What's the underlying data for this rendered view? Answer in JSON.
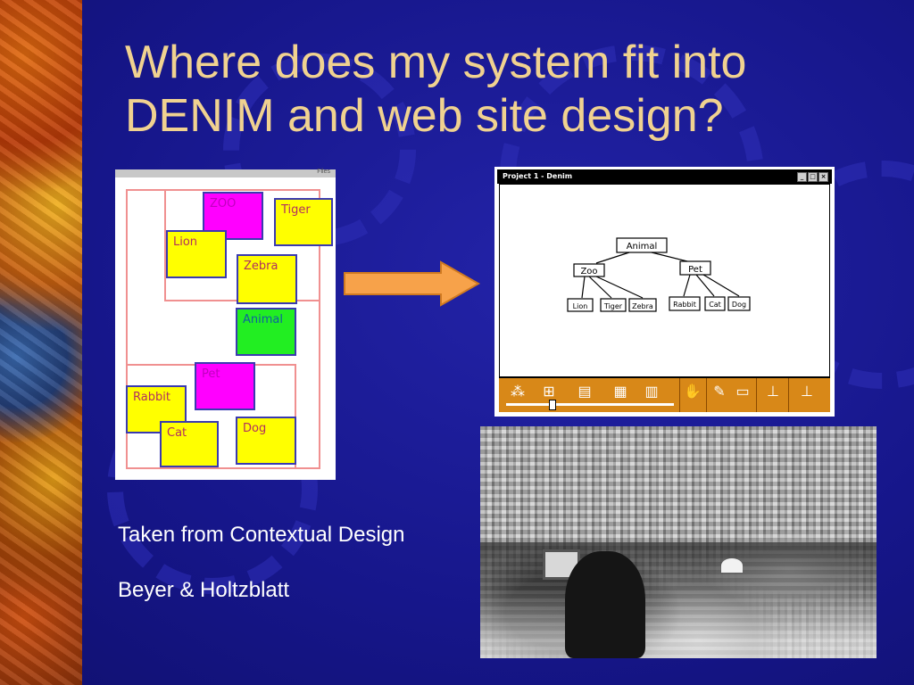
{
  "slide": {
    "title": "Where does my system fit into DENIM and web site design?",
    "caption_line1": "Taken from Contextual Design",
    "caption_line2": "Beyer & Holtzblatt"
  },
  "paper_sketch": {
    "window_label": "Files",
    "notes": [
      "ZOO",
      "Tiger",
      "Lion",
      "Zebra",
      "Animal",
      "Pet",
      "Rabbit",
      "Cat",
      "Dog"
    ]
  },
  "denim_window": {
    "title": "Project 1 - Denim",
    "controls": [
      "_",
      "□",
      "×"
    ],
    "diagram": {
      "root": "Animal",
      "groups": [
        "Zoo",
        "Pet"
      ],
      "leaves": [
        "Lion",
        "Tiger",
        "Zebra",
        "Rabbit",
        "Cat",
        "Dog"
      ]
    },
    "toolbar_icons": [
      "site-map-zoom-icon",
      "storyboard-zoom-icon",
      "sequence-zoom-icon",
      "page-zoom-icon",
      "detail-zoom-icon",
      "hand-icon",
      "pencil-icon",
      "eraser-icon",
      "rubber-stamp-icon",
      "ink-stamp-icon"
    ]
  },
  "colors": {
    "background": "#1a1a8a",
    "title": "#f0d290",
    "sticky_yellow": "#ffff00",
    "sticky_magenta": "#ff00ff",
    "sticky_green": "#22ee22",
    "toolbar": "#d88818",
    "arrow": "#f7a24a"
  }
}
